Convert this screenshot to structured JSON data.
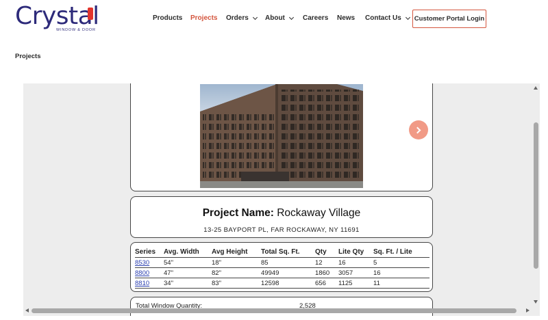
{
  "brand": {
    "name": "Crystal",
    "tagline": "WINDOW & DOOR",
    "primary_color": "#2d2a7a",
    "accent_color": "#e2342d"
  },
  "nav": {
    "items": [
      {
        "label": "Products",
        "active": false,
        "has_dropdown": false
      },
      {
        "label": "Projects",
        "active": true,
        "has_dropdown": false
      },
      {
        "label": "Orders",
        "active": false,
        "has_dropdown": true
      },
      {
        "label": "About",
        "active": false,
        "has_dropdown": true
      },
      {
        "label": "Careers",
        "active": false,
        "has_dropdown": false
      },
      {
        "label": "News",
        "active": false,
        "has_dropdown": false
      },
      {
        "label": "Contact Us",
        "active": false,
        "has_dropdown": true
      }
    ],
    "portal_button": "Customer Portal Login",
    "active_color": "#d4553d"
  },
  "page": {
    "title": "Projects"
  },
  "project": {
    "name_label": "Project Name:",
    "name_value": "Rockaway Village",
    "address": "13-25 BAYPORT PL, FAR ROCKAWAY, NY 11691",
    "next_icon": "chevron-right-icon"
  },
  "table": {
    "headers": [
      "Series",
      "Avg. Width",
      "Avg Height",
      "Total Sq. Ft.",
      "Qty",
      "Lite Qty",
      "Sq. Ft. / Lite"
    ],
    "rows": [
      [
        "8530",
        "54\"",
        "18\"",
        "85",
        "12",
        "16",
        "5"
      ],
      [
        "8800",
        "47\"",
        "82\"",
        "49949",
        "1860",
        "3057",
        "16"
      ],
      [
        "8810",
        "34\"",
        "83\"",
        "12598",
        "656",
        "1125",
        "11"
      ]
    ]
  },
  "totals": {
    "label": "Total Window Quantity:",
    "value": "2,528"
  }
}
